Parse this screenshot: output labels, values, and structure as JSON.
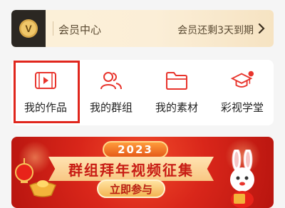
{
  "vip": {
    "title": "会员中心",
    "status": "会员还剩3天到期",
    "badge_letter": "V"
  },
  "shortcuts": [
    {
      "label": "我的作品",
      "icon": "video-frame-icon"
    },
    {
      "label": "我的群组",
      "icon": "group-users-icon"
    },
    {
      "label": "我的素材",
      "icon": "folder-icon"
    },
    {
      "label": "彩视学堂",
      "icon": "graduation-cap-icon"
    }
  ],
  "banner": {
    "year": "2023",
    "title": "群组拜年视频征集",
    "button": "立即参与"
  },
  "colors": {
    "accent": "#e8342c",
    "vip_gold": "#d9b36b",
    "highlight": "#e0261d"
  }
}
